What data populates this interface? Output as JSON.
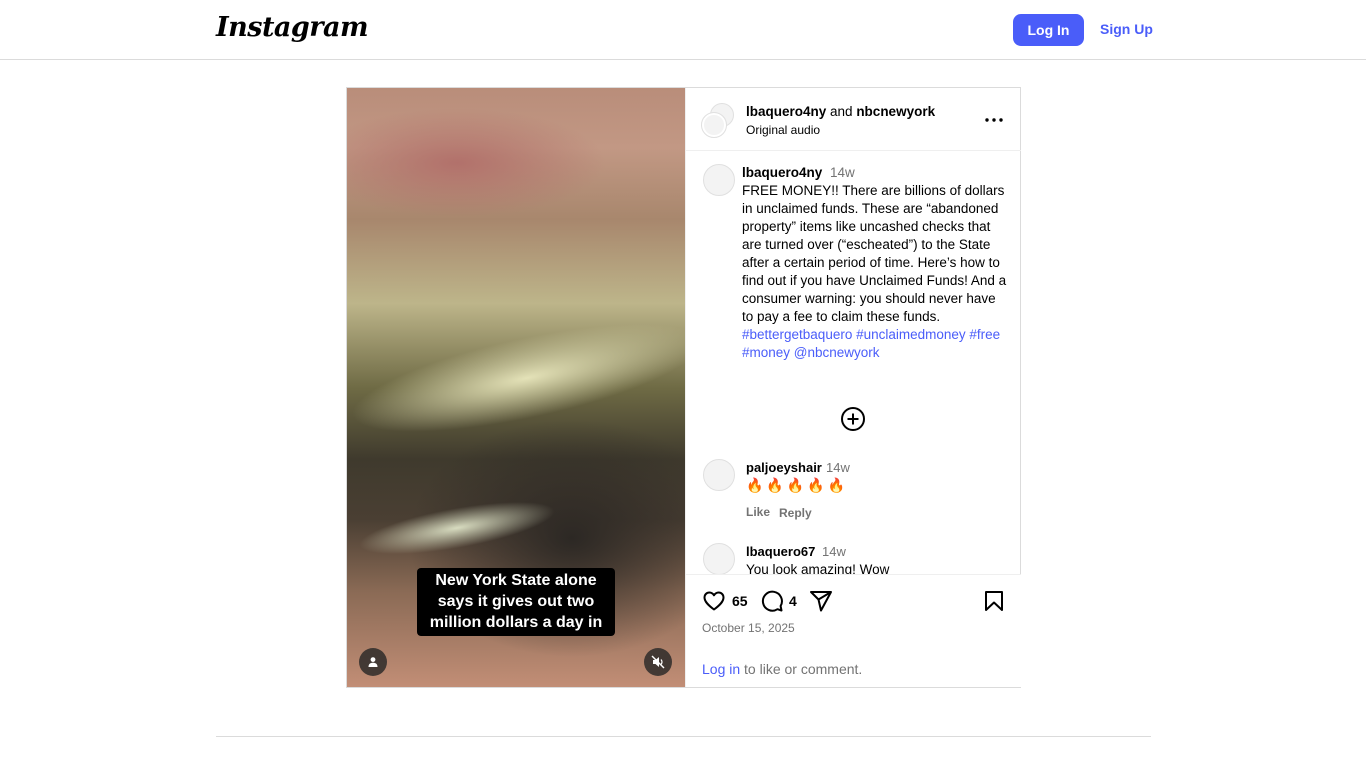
{
  "app": {
    "logo_text": "Instagram",
    "login_label": "Log In",
    "signup_label": "Sign Up",
    "accent_color": "#4a5df9"
  },
  "post": {
    "video_caption": "New York State alone says it gives out two million dollars a day in",
    "header": {
      "author": "lbaquero4ny",
      "connector": " and ",
      "coauthor": "nbcnewyork",
      "audio": "Original audio"
    },
    "caption": {
      "username": "lbaquero4ny",
      "time": "14w",
      "text": "FREE MONEY!! There are billions of dollars in unclaimed funds. These are “abandoned property” items like uncashed checks that are turned over (“escheated”) to the State after a certain period of time. Here’s how to find out if you have Unclaimed Funds! And a consumer warning: you should never have to pay a fee to claim these funds. ",
      "hashtags": "#bettergetbaquero #unclaimedmoney #free #money @nbcnewyork"
    },
    "comments": [
      {
        "username": "paljoeyshair",
        "time": "14w",
        "text": "🔥🔥🔥🔥🔥",
        "like_label": "Like",
        "reply_label": "Reply"
      },
      {
        "username": "lbaquero67",
        "time": "14w",
        "text": "You look amazing! Wow"
      }
    ],
    "likes": "65",
    "comment_count": "4",
    "date": "October 15, 2025",
    "login_link": "Log in",
    "login_suffix": " to like or comment."
  },
  "icons": [
    "heart-icon",
    "comment-icon",
    "share-icon",
    "bookmark-icon",
    "more-icon",
    "add-circle-icon",
    "user-tag-icon",
    "muted-speaker-icon"
  ]
}
